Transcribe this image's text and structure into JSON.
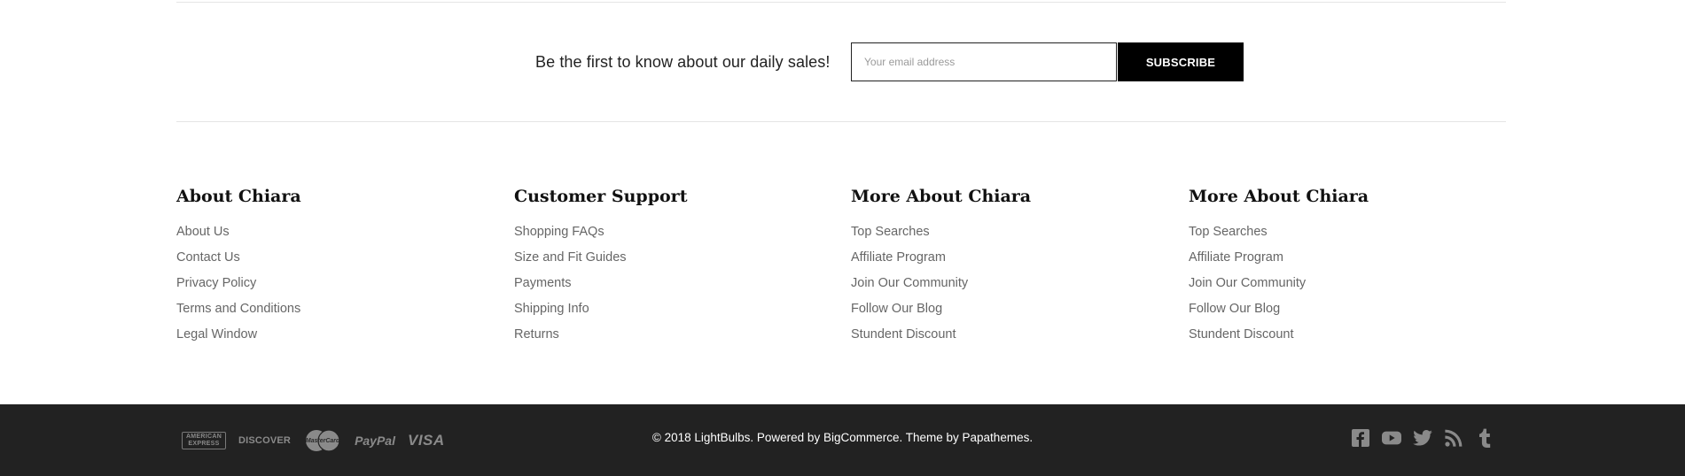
{
  "newsletter": {
    "text": "Be the first to know about our daily sales!",
    "placeholder": "Your email address",
    "button": "SUBSCRIBE"
  },
  "columns": [
    {
      "title": "About Chiara",
      "links": [
        "About Us",
        "Contact Us",
        "Privacy Policy",
        "Terms and Conditions",
        "Legal Window"
      ]
    },
    {
      "title": "Customer Support",
      "links": [
        "Shopping FAQs",
        "Size and Fit Guides",
        "Payments",
        "Shipping Info",
        "Returns"
      ]
    },
    {
      "title": "More About Chiara",
      "links": [
        "Top Searches",
        "Affiliate Program",
        "Join Our Community",
        "Follow Our Blog",
        "Stundent Discount"
      ]
    },
    {
      "title": "More About Chiara",
      "links": [
        "Top Searches",
        "Affiliate Program",
        "Join Our Community",
        "Follow Our Blog",
        "Stundent Discount"
      ]
    }
  ],
  "payments": {
    "amex_line1": "AMERICAN",
    "amex_line2": "EXPRESS",
    "discover": "DISCOVER",
    "mastercard": "MasterCard",
    "paypal": "PayPal",
    "visa": "VISA",
    "icon_names": [
      "amex-icon",
      "discover-icon",
      "mastercard-icon",
      "paypal-icon",
      "visa-icon"
    ]
  },
  "copyright": {
    "prefix": "© 2018 LightBulbs. Powered by ",
    "bigcommerce": "BigCommerce",
    "middle": ". Theme by ",
    "papathemes": "Papathemes",
    "suffix": "."
  },
  "social": [
    "facebook-icon",
    "youtube-icon",
    "twitter-icon",
    "rss-icon",
    "tumblr-icon"
  ],
  "colors": {
    "bottom_bar": "#222222",
    "button": "#000000",
    "link": "#666666",
    "icon": "#8a8a8a"
  }
}
